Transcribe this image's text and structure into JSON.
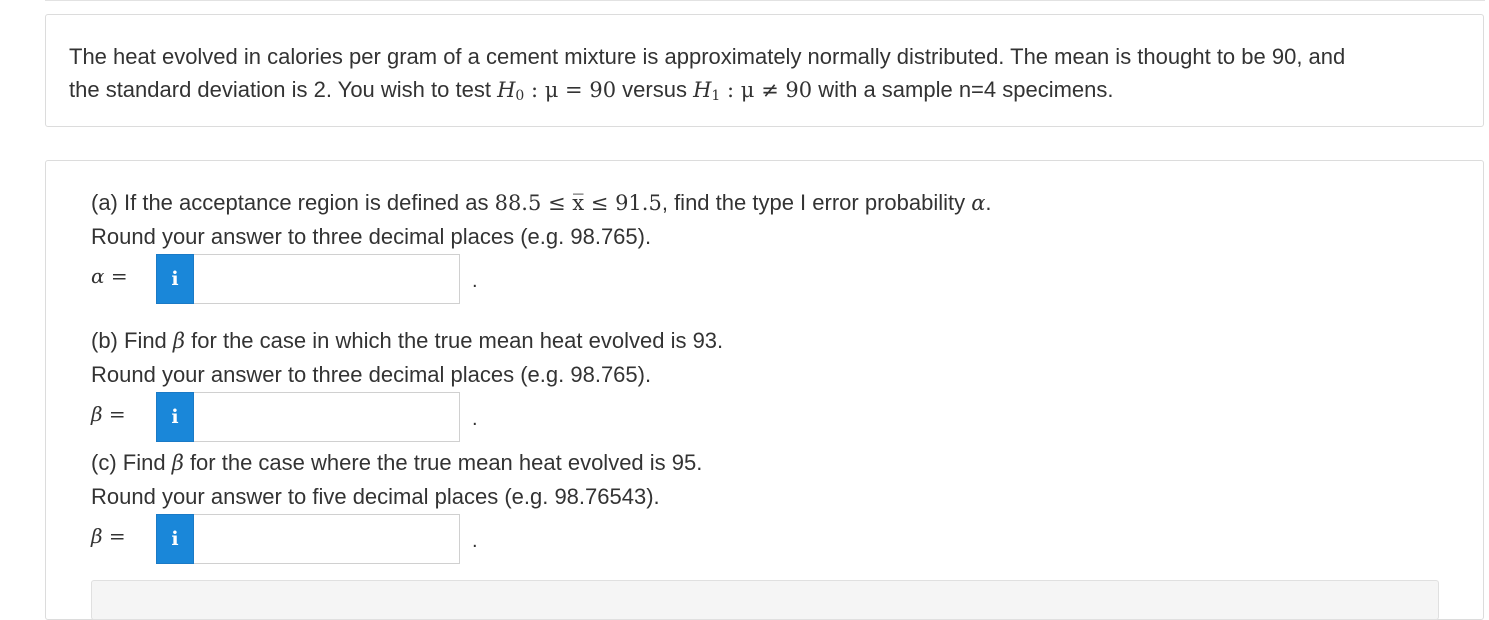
{
  "problem": {
    "line1": "The heat evolved in calories per gram of a cement mixture is approximately normally distributed. The mean is thought to be 90, and",
    "line2_prefix": "the standard deviation is 2. You wish to test ",
    "h0": "H",
    "h0_sub": "0",
    "h0_rel": " : μ = 90",
    "versus": " versus ",
    "h1": "H",
    "h1_sub": "1",
    "h1_rel": " : μ ≠ 90",
    "line2_suffix": " with a sample n=4 specimens."
  },
  "part_a": {
    "text_prefix": "(a) If the acceptance region is defined as ",
    "math_region": "88.5 ≤ x̅ ≤ 91.5",
    "text_mid": ", find the type I error probability ",
    "symbol": "α",
    "text_end": ".",
    "round_instruction": "Round your answer to three decimal places (e.g. 98.765).",
    "answer_label_symbol": "α",
    "answer_label_eq": " =",
    "answer_value": ""
  },
  "part_b": {
    "text_prefix": "(b) Find ",
    "symbol": "β",
    "text_suffix": " for the case in which the true mean heat evolved is 93.",
    "round_instruction": "Round your answer to three decimal places (e.g. 98.765).",
    "answer_label_symbol": "β",
    "answer_label_eq": " =",
    "answer_value": ""
  },
  "part_c": {
    "text_prefix": "(c) Find ",
    "symbol": "β",
    "text_suffix": " for the case where the true mean heat evolved is 95.",
    "round_instruction": "Round your answer to five decimal places (e.g. 98.76543).",
    "answer_label_symbol": "β",
    "answer_label_eq": " =",
    "answer_value": ""
  },
  "info_button_label": "i",
  "trailing_dot": ".",
  "colors": {
    "info_button": "#1a87d9",
    "text": "#333333",
    "border": "#dcdcdc"
  }
}
